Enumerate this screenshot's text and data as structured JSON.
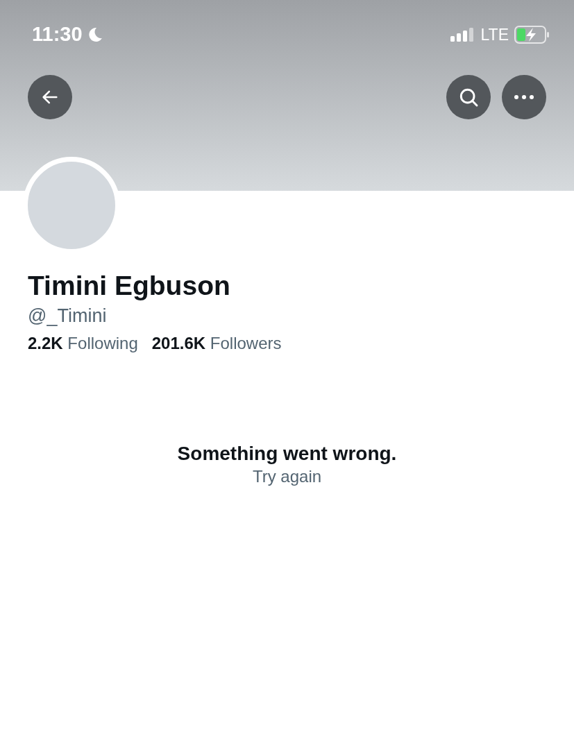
{
  "status_bar": {
    "time": "11:30",
    "network": "LTE"
  },
  "profile": {
    "name": "Timini Egbuson",
    "handle": "@_Timini",
    "stats": [
      {
        "count": "2.2K",
        "label": "Following"
      },
      {
        "count": "201.6K",
        "label": "Followers"
      }
    ]
  },
  "error": {
    "message": "Something went wrong.",
    "action": "Try again"
  }
}
